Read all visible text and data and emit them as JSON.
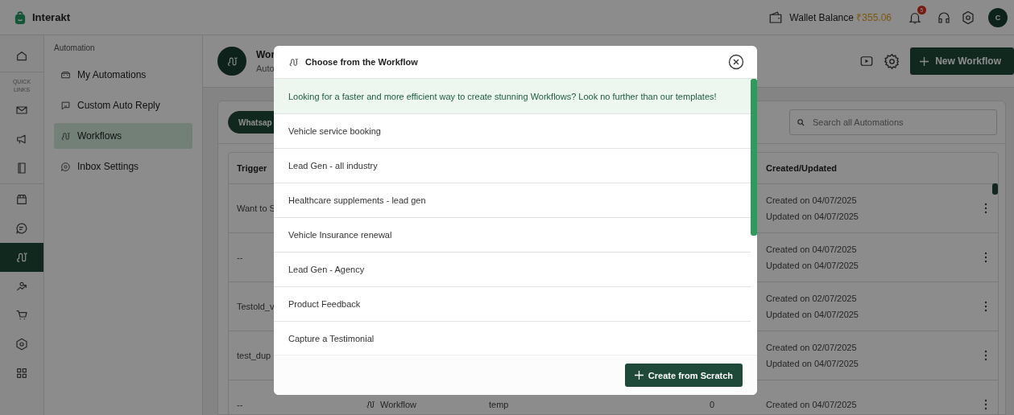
{
  "top_bar": {
    "brand": "Interakt",
    "wallet_label": "Wallet Balance",
    "wallet_amount": "₹355.06",
    "notification_count": "5",
    "avatar_initial": "C"
  },
  "icon_rail": {
    "quick_links_label": "QUICK LINKS",
    "items": [
      {
        "selected": false
      },
      {
        "selected": false
      },
      {
        "selected": false
      },
      {
        "selected": false
      },
      {
        "selected": false
      },
      {
        "selected": false
      },
      {
        "selected": true
      },
      {
        "selected": false
      },
      {
        "selected": false
      },
      {
        "selected": false
      },
      {
        "selected": false
      }
    ]
  },
  "sidebar": {
    "heading": "Automation",
    "items": [
      {
        "label": "My Automations",
        "selected": false
      },
      {
        "label": "Custom Auto Reply",
        "selected": false
      },
      {
        "label": "Workflows",
        "selected": true
      },
      {
        "label": "Inbox Settings",
        "selected": false
      }
    ]
  },
  "header": {
    "title": "Wor",
    "subtitle": "Auto",
    "button": "New Workflow"
  },
  "tabs": [
    {
      "label": "Whatsap",
      "selected": true
    }
  ],
  "search": {
    "placeholder": "Search all Automations"
  },
  "table": {
    "columns": {
      "trigger": "Trigger",
      "created_updated": "Created/Updated"
    },
    "rows": [
      {
        "trigger": "Want to S",
        "created": "Created on 04/07/2025",
        "updated": "Updated on 04/07/2025"
      },
      {
        "trigger": "--",
        "created": "Created on 04/07/2025",
        "updated": "Updated on 04/07/2025"
      },
      {
        "trigger": "Testold_v",
        "created": "Created on 02/07/2025",
        "updated": "Updated on 04/07/2025"
      },
      {
        "trigger": "test_dup",
        "created": "Created on 02/07/2025",
        "updated": "Updated on 04/07/2025"
      },
      {
        "trigger": "--",
        "column_2": "Workflow",
        "column_3": "temp",
        "column_4": "0",
        "created": "Created on 04/07/2025"
      }
    ]
  },
  "modal": {
    "title": "Choose from the Workflow",
    "banner": "Looking for a faster and more efficient way to create stunning Workflows? Look no further than our templates!",
    "templates": [
      "Vehicle service booking",
      "Lead Gen - all industry",
      "Healthcare supplements - lead gen",
      "Vehicle Insurance renewal",
      "Lead Gen - Agency",
      "Product Feedback",
      "Capture a Testimonial"
    ],
    "button": "Create from Scratch"
  }
}
